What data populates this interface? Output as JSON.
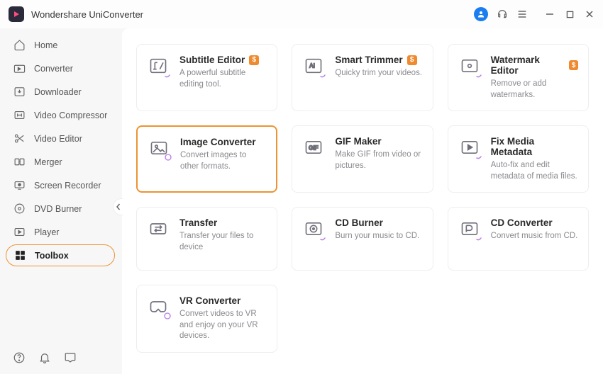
{
  "app": {
    "title": "Wondershare UniConverter"
  },
  "colors": {
    "accent": "#ec9333",
    "accountBg": "#1b7ef0"
  },
  "sidebar": {
    "items": [
      {
        "label": "Home"
      },
      {
        "label": "Converter"
      },
      {
        "label": "Downloader"
      },
      {
        "label": "Video Compressor"
      },
      {
        "label": "Video Editor"
      },
      {
        "label": "Merger"
      },
      {
        "label": "Screen Recorder"
      },
      {
        "label": "DVD Burner"
      },
      {
        "label": "Player"
      },
      {
        "label": "Toolbox"
      }
    ],
    "activeIndex": 9
  },
  "toolbox": {
    "cards": [
      {
        "title": "Subtitle Editor",
        "desc": "A powerful subtitle editing tool.",
        "pro": true
      },
      {
        "title": "Smart Trimmer",
        "desc": "Quicky trim your videos.",
        "pro": true
      },
      {
        "title": "Watermark Editor",
        "desc": "Remove or add watermarks.",
        "pro": true
      },
      {
        "title": "Image Converter",
        "desc": "Convert images to other formats.",
        "pro": false
      },
      {
        "title": "GIF Maker",
        "desc": "Make GIF from video or pictures.",
        "pro": false
      },
      {
        "title": "Fix Media Metadata",
        "desc": "Auto-fix and edit metadata of media files.",
        "pro": false
      },
      {
        "title": "Transfer",
        "desc": "Transfer your files to device",
        "pro": false
      },
      {
        "title": "CD Burner",
        "desc": "Burn your music to CD.",
        "pro": false
      },
      {
        "title": "CD Converter",
        "desc": "Convert music from CD.",
        "pro": false
      },
      {
        "title": "VR Converter",
        "desc": "Convert videos to VR and enjoy on your VR devices.",
        "pro": false
      }
    ],
    "activeIndex": 3,
    "badgeGlyph": "$"
  }
}
